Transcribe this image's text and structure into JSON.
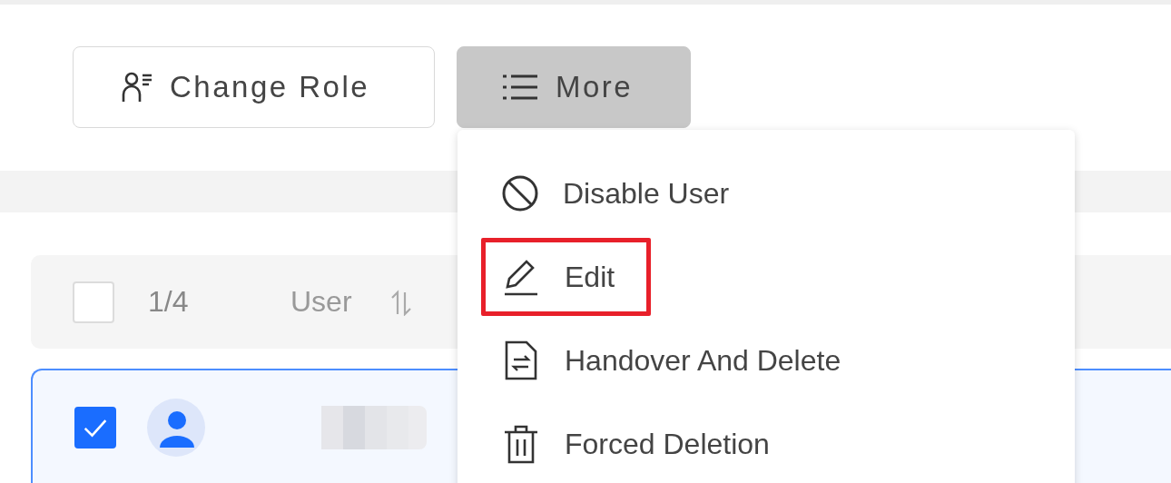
{
  "toolbar": {
    "buttons": [
      {
        "label": "Change Role",
        "kind": "role",
        "pressed": false
      },
      {
        "label": "More",
        "kind": "list",
        "pressed": true
      }
    ]
  },
  "table": {
    "header": {
      "checked": false,
      "count": "1/4",
      "columns": [
        {
          "label": "User",
          "sortable": true
        }
      ]
    },
    "rows": [
      {
        "selected": true,
        "checked": true
      }
    ]
  },
  "menu": {
    "items": [
      {
        "label": "Disable User",
        "kind": "disable",
        "highlighted": false
      },
      {
        "label": "Edit",
        "kind": "edit",
        "highlighted": true
      },
      {
        "label": "Handover And Delete",
        "kind": "handover",
        "highlighted": false
      },
      {
        "label": "Forced Deletion",
        "kind": "delete",
        "highlighted": false
      }
    ]
  }
}
